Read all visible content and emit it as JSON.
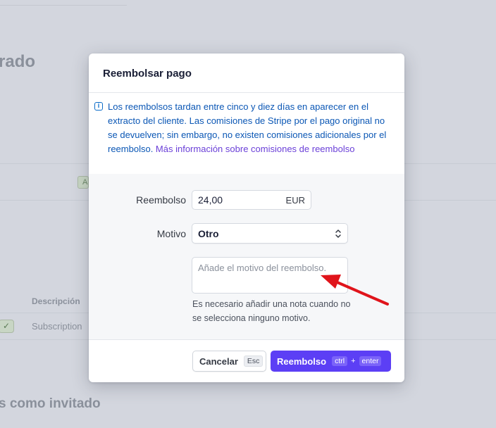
{
  "background": {
    "heading_fragment": "rado",
    "badge_fragment": "A",
    "column_header": "Descripción",
    "row_cell": "Subscription",
    "check_glyph": "✓",
    "guest_heading": "s como invitado"
  },
  "modal": {
    "title": "Reembolsar pago",
    "notice": {
      "icon": "info-icon",
      "text": "Los reembolsos tardan entre cinco y diez días en aparecer en el extracto del cliente. Las comisiones de Stripe por el pago original no se devuelven; sin embargo, no existen comisiones adicionales por el reembolso. ",
      "link": "Más información sobre comisiones de reembolso"
    },
    "form": {
      "amount_label": "Reembolso",
      "amount_value": "24,00",
      "currency": "EUR",
      "reason_label": "Motivo",
      "reason_value": "Otro",
      "note_placeholder": "Añade el motivo del reembolso.",
      "hint": "Es necesario añadir una nota cuando no se selecciona ninguno motivo."
    },
    "footer": {
      "cancel_label": "Cancelar",
      "cancel_shortcut": "Esc",
      "refund_label": "Reembolso",
      "refund_shortcut_1": "ctrl",
      "refund_plus": "+",
      "refund_shortcut_2": "enter"
    }
  },
  "colors": {
    "primary": "#5c3ff5",
    "notice_text": "#0b57b5",
    "notice_link": "#6b40d8",
    "annotation_arrow": "#e0141b"
  }
}
